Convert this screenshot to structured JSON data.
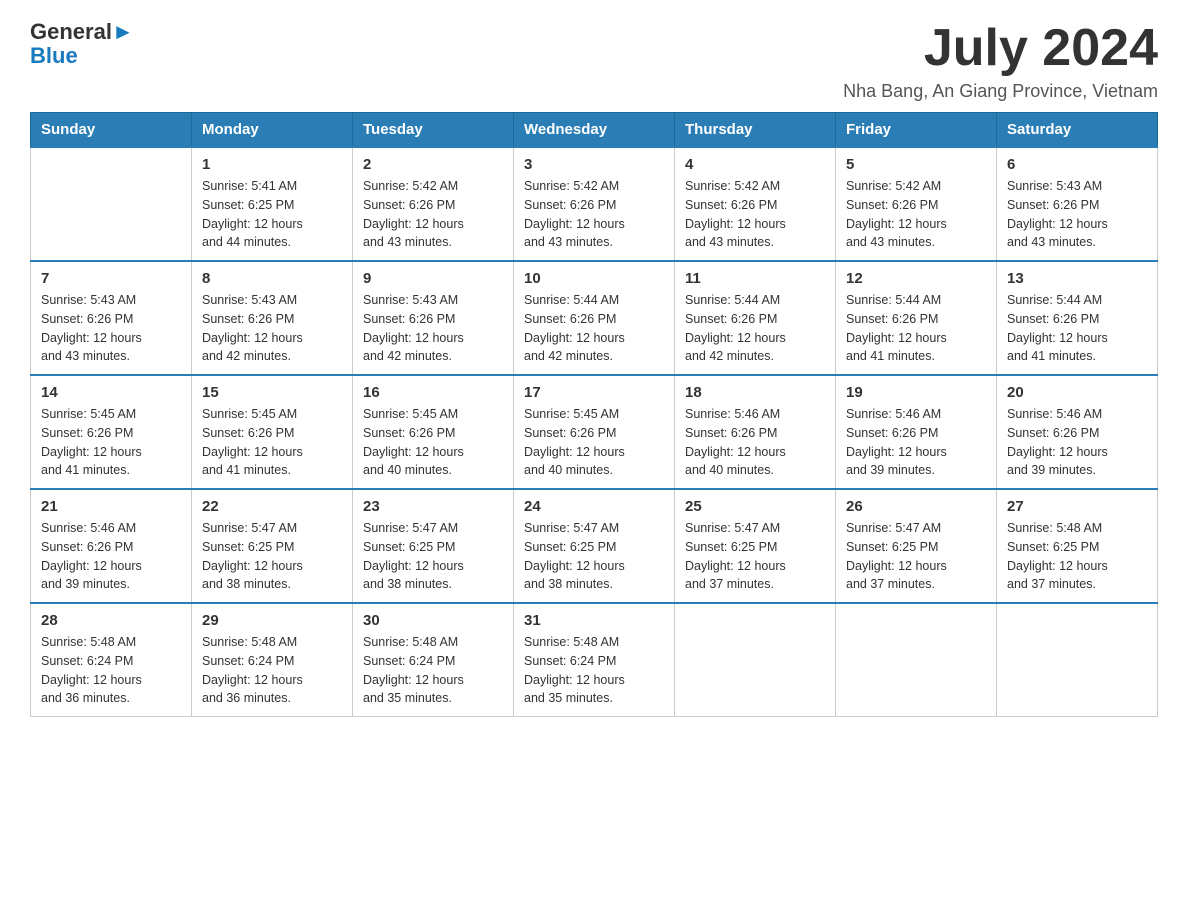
{
  "header": {
    "logo_text_general": "General",
    "logo_text_blue": "Blue",
    "month_title": "July 2024",
    "location": "Nha Bang, An Giang Province, Vietnam"
  },
  "days_of_week": [
    "Sunday",
    "Monday",
    "Tuesday",
    "Wednesday",
    "Thursday",
    "Friday",
    "Saturday"
  ],
  "weeks": [
    {
      "days": [
        {
          "num": "",
          "info": ""
        },
        {
          "num": "1",
          "info": "Sunrise: 5:41 AM\nSunset: 6:25 PM\nDaylight: 12 hours\nand 44 minutes."
        },
        {
          "num": "2",
          "info": "Sunrise: 5:42 AM\nSunset: 6:26 PM\nDaylight: 12 hours\nand 43 minutes."
        },
        {
          "num": "3",
          "info": "Sunrise: 5:42 AM\nSunset: 6:26 PM\nDaylight: 12 hours\nand 43 minutes."
        },
        {
          "num": "4",
          "info": "Sunrise: 5:42 AM\nSunset: 6:26 PM\nDaylight: 12 hours\nand 43 minutes."
        },
        {
          "num": "5",
          "info": "Sunrise: 5:42 AM\nSunset: 6:26 PM\nDaylight: 12 hours\nand 43 minutes."
        },
        {
          "num": "6",
          "info": "Sunrise: 5:43 AM\nSunset: 6:26 PM\nDaylight: 12 hours\nand 43 minutes."
        }
      ]
    },
    {
      "days": [
        {
          "num": "7",
          "info": "Sunrise: 5:43 AM\nSunset: 6:26 PM\nDaylight: 12 hours\nand 43 minutes."
        },
        {
          "num": "8",
          "info": "Sunrise: 5:43 AM\nSunset: 6:26 PM\nDaylight: 12 hours\nand 42 minutes."
        },
        {
          "num": "9",
          "info": "Sunrise: 5:43 AM\nSunset: 6:26 PM\nDaylight: 12 hours\nand 42 minutes."
        },
        {
          "num": "10",
          "info": "Sunrise: 5:44 AM\nSunset: 6:26 PM\nDaylight: 12 hours\nand 42 minutes."
        },
        {
          "num": "11",
          "info": "Sunrise: 5:44 AM\nSunset: 6:26 PM\nDaylight: 12 hours\nand 42 minutes."
        },
        {
          "num": "12",
          "info": "Sunrise: 5:44 AM\nSunset: 6:26 PM\nDaylight: 12 hours\nand 41 minutes."
        },
        {
          "num": "13",
          "info": "Sunrise: 5:44 AM\nSunset: 6:26 PM\nDaylight: 12 hours\nand 41 minutes."
        }
      ]
    },
    {
      "days": [
        {
          "num": "14",
          "info": "Sunrise: 5:45 AM\nSunset: 6:26 PM\nDaylight: 12 hours\nand 41 minutes."
        },
        {
          "num": "15",
          "info": "Sunrise: 5:45 AM\nSunset: 6:26 PM\nDaylight: 12 hours\nand 41 minutes."
        },
        {
          "num": "16",
          "info": "Sunrise: 5:45 AM\nSunset: 6:26 PM\nDaylight: 12 hours\nand 40 minutes."
        },
        {
          "num": "17",
          "info": "Sunrise: 5:45 AM\nSunset: 6:26 PM\nDaylight: 12 hours\nand 40 minutes."
        },
        {
          "num": "18",
          "info": "Sunrise: 5:46 AM\nSunset: 6:26 PM\nDaylight: 12 hours\nand 40 minutes."
        },
        {
          "num": "19",
          "info": "Sunrise: 5:46 AM\nSunset: 6:26 PM\nDaylight: 12 hours\nand 39 minutes."
        },
        {
          "num": "20",
          "info": "Sunrise: 5:46 AM\nSunset: 6:26 PM\nDaylight: 12 hours\nand 39 minutes."
        }
      ]
    },
    {
      "days": [
        {
          "num": "21",
          "info": "Sunrise: 5:46 AM\nSunset: 6:26 PM\nDaylight: 12 hours\nand 39 minutes."
        },
        {
          "num": "22",
          "info": "Sunrise: 5:47 AM\nSunset: 6:25 PM\nDaylight: 12 hours\nand 38 minutes."
        },
        {
          "num": "23",
          "info": "Sunrise: 5:47 AM\nSunset: 6:25 PM\nDaylight: 12 hours\nand 38 minutes."
        },
        {
          "num": "24",
          "info": "Sunrise: 5:47 AM\nSunset: 6:25 PM\nDaylight: 12 hours\nand 38 minutes."
        },
        {
          "num": "25",
          "info": "Sunrise: 5:47 AM\nSunset: 6:25 PM\nDaylight: 12 hours\nand 37 minutes."
        },
        {
          "num": "26",
          "info": "Sunrise: 5:47 AM\nSunset: 6:25 PM\nDaylight: 12 hours\nand 37 minutes."
        },
        {
          "num": "27",
          "info": "Sunrise: 5:48 AM\nSunset: 6:25 PM\nDaylight: 12 hours\nand 37 minutes."
        }
      ]
    },
    {
      "days": [
        {
          "num": "28",
          "info": "Sunrise: 5:48 AM\nSunset: 6:24 PM\nDaylight: 12 hours\nand 36 minutes."
        },
        {
          "num": "29",
          "info": "Sunrise: 5:48 AM\nSunset: 6:24 PM\nDaylight: 12 hours\nand 36 minutes."
        },
        {
          "num": "30",
          "info": "Sunrise: 5:48 AM\nSunset: 6:24 PM\nDaylight: 12 hours\nand 35 minutes."
        },
        {
          "num": "31",
          "info": "Sunrise: 5:48 AM\nSunset: 6:24 PM\nDaylight: 12 hours\nand 35 minutes."
        },
        {
          "num": "",
          "info": ""
        },
        {
          "num": "",
          "info": ""
        },
        {
          "num": "",
          "info": ""
        }
      ]
    }
  ]
}
